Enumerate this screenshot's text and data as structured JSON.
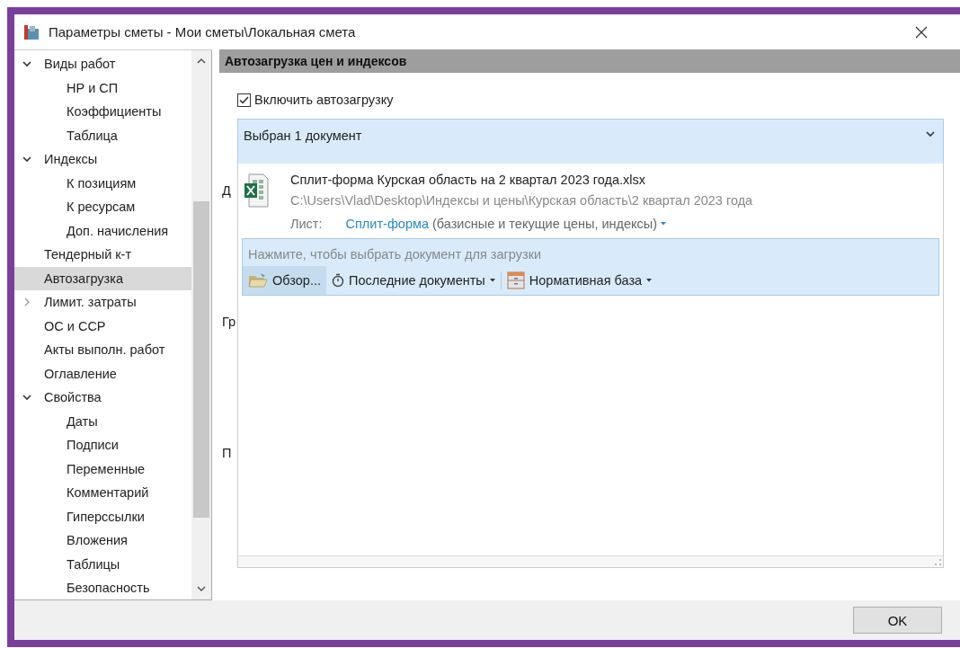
{
  "window": {
    "title": "Параметры сметы - Мои сметы\\Локальная смета"
  },
  "sidebar": {
    "items": [
      {
        "label": "Виды работ",
        "kind": "node",
        "expanded": true,
        "selected": false,
        "children": [
          {
            "label": "НР и СП",
            "selected": false
          },
          {
            "label": "Коэффициенты",
            "selected": false
          },
          {
            "label": "Таблица",
            "selected": false
          }
        ]
      },
      {
        "label": "Индексы",
        "kind": "node",
        "expanded": true,
        "selected": false,
        "children": [
          {
            "label": "К позициям",
            "selected": false
          },
          {
            "label": "К ресурсам",
            "selected": false
          },
          {
            "label": "Доп. начисления",
            "selected": false
          }
        ]
      },
      {
        "label": "Тендерный к-т",
        "kind": "leaf",
        "selected": false
      },
      {
        "label": "Автозагрузка",
        "kind": "leaf",
        "selected": true
      },
      {
        "label": "Лимит. затраты",
        "kind": "node",
        "expanded": false,
        "selected": false
      },
      {
        "label": "ОС и ССР",
        "kind": "leaf",
        "selected": false
      },
      {
        "label": "Акты выполн. работ",
        "kind": "leaf",
        "selected": false
      },
      {
        "label": "Оглавление",
        "kind": "leaf",
        "selected": false
      },
      {
        "label": "Свойства",
        "kind": "node",
        "expanded": true,
        "selected": false,
        "children": [
          {
            "label": "Даты",
            "selected": false
          },
          {
            "label": "Подписи",
            "selected": false
          },
          {
            "label": "Переменные",
            "selected": false
          },
          {
            "label": "Комментарий",
            "selected": false
          },
          {
            "label": "Гиперссылки",
            "selected": false
          },
          {
            "label": "Вложения",
            "selected": false
          },
          {
            "label": "Таблицы",
            "selected": false
          },
          {
            "label": "Безопасность",
            "selected": false
          }
        ]
      }
    ]
  },
  "panel": {
    "title": "Автозагрузка цен и индексов",
    "autoload": {
      "label": "Включить автозагрузку",
      "checked": true
    },
    "background_labels": [
      "Д",
      "Гр",
      "П"
    ],
    "document_select": {
      "value": "Выбран 1 документ",
      "expanded": true
    },
    "documents": [
      {
        "name": "Сплит-форма Курская область на 2 квартал 2023 года.xlsx",
        "path": "C:\\Users\\Vlad\\Desktop\\Индексы и цены\\Курская область\\2 квартал 2023 года",
        "sheet_label": "Лист:",
        "sheet_name": "Сплит-форма",
        "sheet_note": "(базисные и текущие цены, индексы)"
      }
    ],
    "picker": {
      "hint": "Нажмите, чтобы выбрать документ для загрузки",
      "tools": [
        {
          "label": "Обзор...",
          "kind": "browse",
          "selected": true,
          "dropdown": false
        },
        {
          "label": "Последние документы",
          "kind": "recent",
          "selected": false,
          "dropdown": true
        },
        {
          "label": "Нормативная база",
          "kind": "base",
          "selected": false,
          "dropdown": true
        }
      ]
    }
  },
  "footer": {
    "buttons": [
      "OK"
    ]
  }
}
